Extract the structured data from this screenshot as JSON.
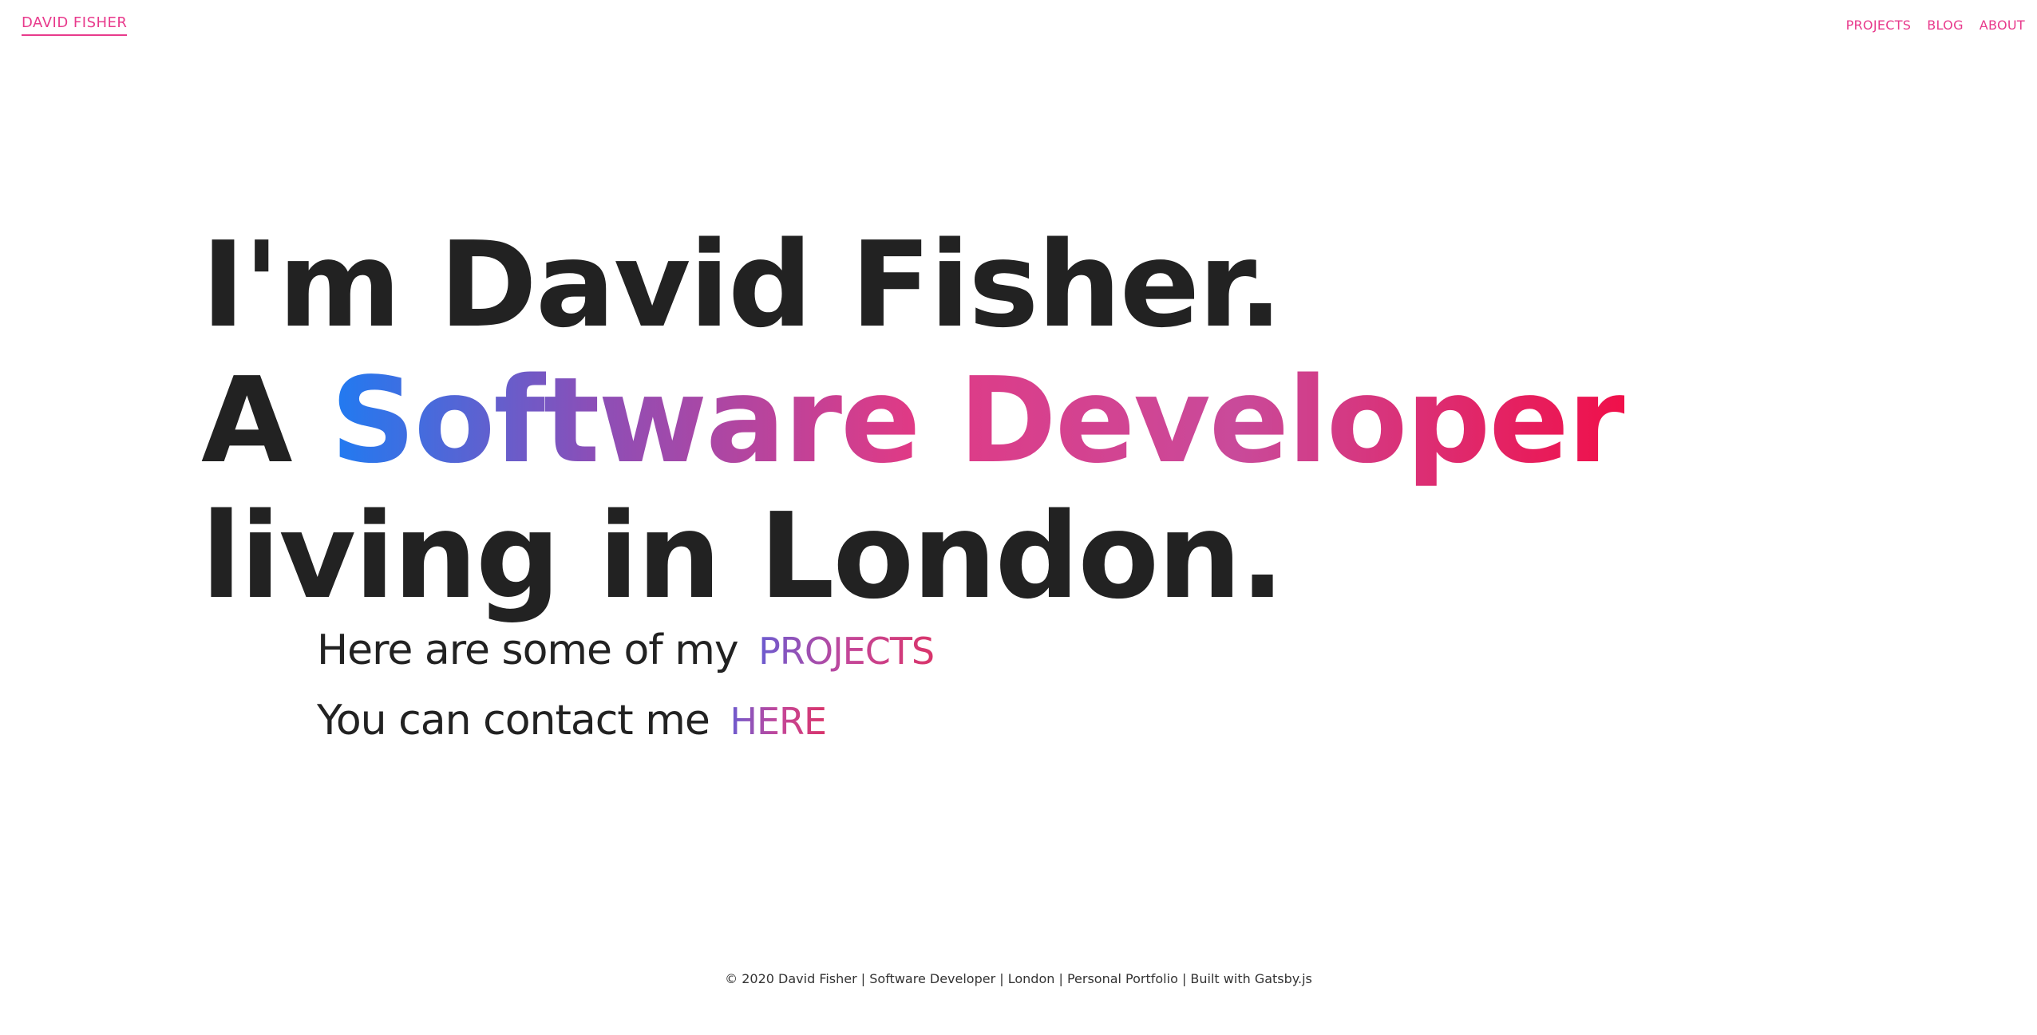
{
  "header": {
    "brand": "DAVID FISHER",
    "nav": [
      "PROJECTS",
      "BLOG",
      "ABOUT"
    ]
  },
  "hero": {
    "line1": "I'm David Fisher.",
    "line2_prefix": "A",
    "line2_highlight": "Software Developer",
    "line3": "living in London."
  },
  "links": {
    "projects_text": "Here are some of my",
    "projects_link": "PROJECTS",
    "contact_text": "You can contact me",
    "contact_link": "HERE"
  },
  "footer": {
    "text": "© 2020 David Fisher | Software Developer | London | Personal Portfolio | Built with Gatsby.js"
  },
  "colors": {
    "accent": "#e83a8c",
    "text": "#222222",
    "gradient_start": "#1f7bf2",
    "gradient_end": "#f0104a"
  }
}
